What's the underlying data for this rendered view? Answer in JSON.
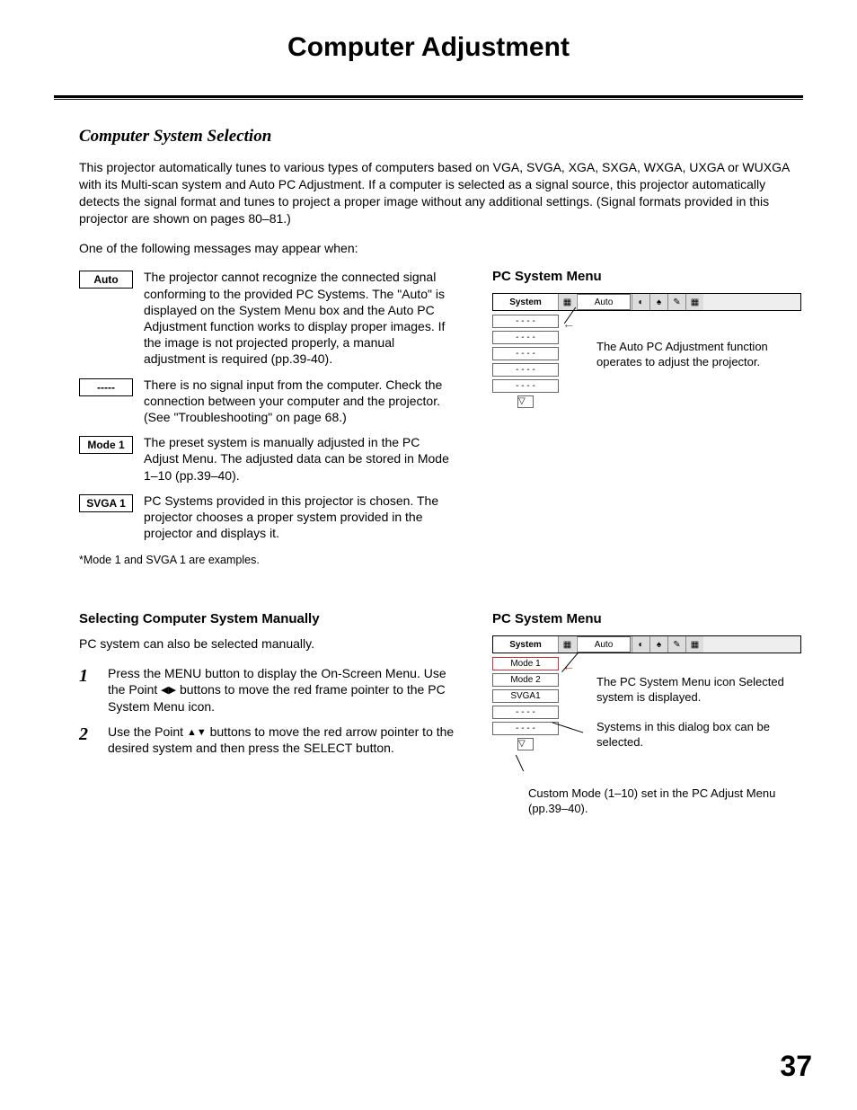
{
  "page_title": "Computer Adjustment",
  "section_heading": "Computer System Selection",
  "intro": "This projector automatically tunes to various types of computers based on VGA, SVGA, XGA, SXGA, WXGA, UXGA or WUXGA with its Multi-scan system and Auto PC Adjustment. If a computer is selected as a signal source, this projector automatically detects the signal format and tunes to project a proper image without any additional settings. (Signal formats provided in this projector are shown on pages 80–81.)",
  "msg_intro": "One of the following messages may appear when:",
  "messages": [
    {
      "label": "Auto",
      "text": "The projector cannot recognize the connected signal conforming to the provided PC Systems. The \"Auto\" is displayed on the System Menu box and the Auto PC Adjustment function works to display proper images. If the image is not projected properly, a manual adjustment is required (pp.39-40)."
    },
    {
      "label": "-----",
      "text": "There is no signal input from the computer. Check the connection between your computer and the projector. (See \"Troubleshooting\" on page 68.)"
    },
    {
      "label": "Mode 1",
      "text": "The preset system is manually adjusted in the PC Adjust Menu. The adjusted data can be stored in Mode 1–10 (pp.39–40)."
    },
    {
      "label": "SVGA 1",
      "text": "PC Systems provided in this projector is chosen. The projector chooses a proper system provided in the projector and displays it."
    }
  ],
  "footnote": "*Mode 1 and SVGA 1 are examples.",
  "menu1": {
    "title": "PC System Menu",
    "system_label": "System",
    "auto_label": "Auto",
    "items": [
      "- - - -",
      "- - - -",
      "- - - -",
      "- - - -",
      "- - - -"
    ],
    "callout": "The Auto PC Adjustment function operates to adjust the projector."
  },
  "section2": {
    "heading": "Selecting Computer System Manually",
    "intro": "PC system can also be selected manually.",
    "steps": [
      {
        "num": "1",
        "text_before": "Press the MENU button to display the On-Screen Menu. Use the Point ",
        "arrows": "◀▶",
        "text_after": " buttons to move the red frame pointer to the PC System Menu icon."
      },
      {
        "num": "2",
        "text_before": "Use the Point ",
        "arrows": "▲▼",
        "text_after": " buttons to move the red arrow pointer to the desired system and then press the SELECT button."
      }
    ]
  },
  "menu2": {
    "title": "PC System Menu",
    "system_label": "System",
    "auto_label": "Auto",
    "items": [
      "Mode 1",
      "Mode 2",
      "SVGA1",
      "- - - -",
      "- - - -"
    ],
    "callout1": "The PC System Menu icon Selected system is displayed.",
    "callout2": "Systems in this dialog box can be selected.",
    "custom_note": "Custom Mode (1–10) set in the PC Adjust Menu (pp.39–40)."
  },
  "page_number": "37"
}
